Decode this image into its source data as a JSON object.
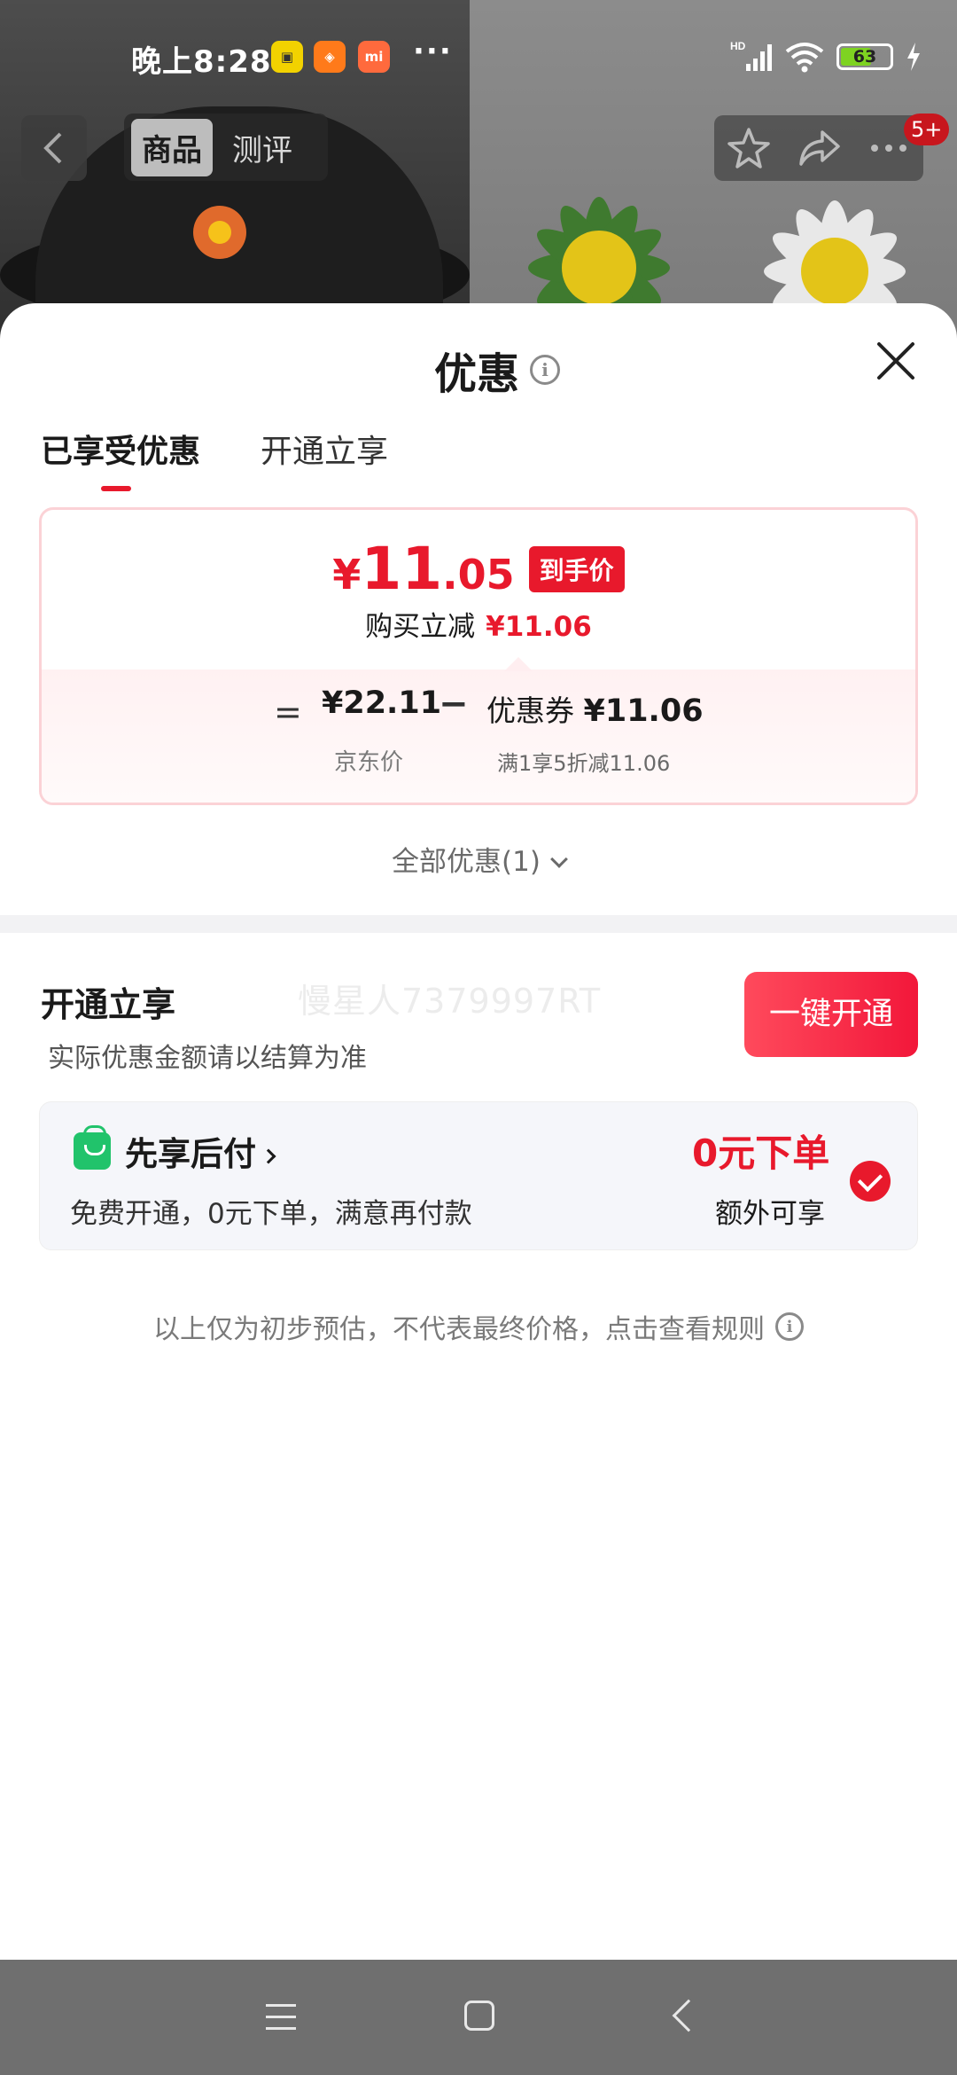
{
  "status_bar": {
    "time": "晚上8:28",
    "app_icons": [
      "pocket-app-icon",
      "taobao-app-icon",
      "mi-app-icon"
    ],
    "mi_label": "mi",
    "more": "···",
    "network": "HD",
    "battery": "63",
    "battery_level": 0.63
  },
  "product_nav": {
    "tabs": [
      {
        "label": "商品",
        "active": true
      },
      {
        "label": "测评",
        "active": false
      }
    ],
    "badge": "5+"
  },
  "sheet": {
    "title": "优惠",
    "tabs": [
      {
        "label": "已享受优惠",
        "active": true
      },
      {
        "label": "开通立享",
        "active": false
      }
    ],
    "price_card": {
      "currency": "¥",
      "price_int": "11",
      "price_dec": ".05",
      "price_tag": "到手价",
      "discount_label": "购买立减",
      "discount_value": "¥11.06",
      "calc": {
        "equals": "=",
        "base_value": "¥22.11",
        "base_label": "京东价",
        "minus": "−",
        "coupon_label": "优惠券",
        "coupon_value": "¥11.06",
        "coupon_rule": "满1享5折减11.06"
      }
    },
    "all_offers": "全部优惠(1)",
    "open_section": {
      "title": "开通立享",
      "subtitle": "实际优惠金额请以结算为准",
      "watermark": "慢星人7379997RT",
      "button": "一键开通"
    },
    "pay_later": {
      "title": "先享后付",
      "desc": "免费开通，0元下单，满意再付款",
      "highlight": "0元下单",
      "extra": "额外可享",
      "checked": true
    },
    "footer_note": "以上仅为初步预估，不代表最终价格，点击查看规则"
  },
  "colors": {
    "accent_red": "#e8192c",
    "green": "#21c36b",
    "card_border": "#fbd2d6"
  }
}
